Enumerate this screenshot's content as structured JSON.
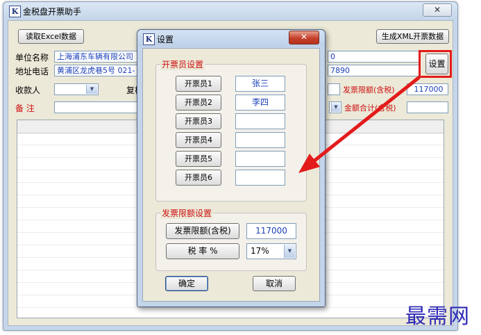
{
  "main_window": {
    "title": "金税盘开票助手",
    "close_glyph": "✕",
    "toolbar": {
      "read_excel_label": "读取Excel数据",
      "gen_xml_label": "生成XML开票数据",
      "settings_label": "设置"
    },
    "form": {
      "company_name_label": "单位名称",
      "company_name_value": "上海浦东车辆有限公司",
      "company_name_tail": "0",
      "address_phone_label": "地址电话",
      "address_phone_value": "黄浦区龙虎巷5号  021-",
      "address_phone_tail": "7890",
      "payee_label": "收款人",
      "reviewer_label": "复核",
      "invoice_limit_label": "发票限额(含税)",
      "invoice_limit_value": "117000",
      "remark_label": "备    注",
      "total_amount_label": "金额合计(含税)"
    }
  },
  "dialog": {
    "title": "设置",
    "close_glyph": "✕",
    "issuer_group": {
      "title": "开票员设置",
      "issuers": [
        {
          "label": "开票员1",
          "value": "张三"
        },
        {
          "label": "开票员2",
          "value": "李四"
        },
        {
          "label": "开票员3",
          "value": ""
        },
        {
          "label": "开票员4",
          "value": ""
        },
        {
          "label": "开票员5",
          "value": ""
        },
        {
          "label": "开票员6",
          "value": ""
        }
      ]
    },
    "limit_group": {
      "title": "发票限额设置",
      "limit_button_label": "发票限额(含税)",
      "limit_value": "117000",
      "tax_rate_button_label": "税 率 %",
      "tax_rate_value": "17%"
    },
    "ok_label": "确定",
    "cancel_label": "取消"
  },
  "watermark": "最需网",
  "colors": {
    "accent_red": "#e31b1b",
    "label_red": "#cc1111",
    "field_text_blue": "#1a3fb8",
    "watermark_blue": "#2e2ab6"
  }
}
